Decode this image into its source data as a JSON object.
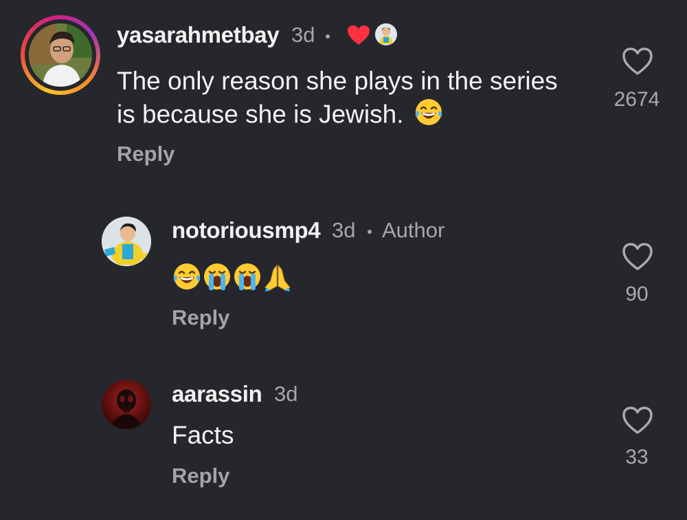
{
  "comments": [
    {
      "username": "yasarahmetbay",
      "time": "3d",
      "text_line1": "The only reason she plays in the series",
      "text_line2": "is because she is Jewish.",
      "emoji": "face-with-tears-of-joy",
      "reply": "Reply",
      "likes": "2674",
      "liked_by_author": true,
      "has_story": true
    },
    {
      "username": "notoriousmp4",
      "time": "3d",
      "badge": "Author",
      "emojis": [
        "face-with-tears-of-joy",
        "loudly-crying-face",
        "loudly-crying-face",
        "folded-hands"
      ],
      "reply": "Reply",
      "likes": "90"
    },
    {
      "username": "aarassin",
      "time": "3d",
      "text": "Facts",
      "reply": "Reply",
      "likes": "33"
    }
  ],
  "colors": {
    "background": "#26272c",
    "heart_red": "#ff3040",
    "secondary_text": "#a6a7ac"
  }
}
